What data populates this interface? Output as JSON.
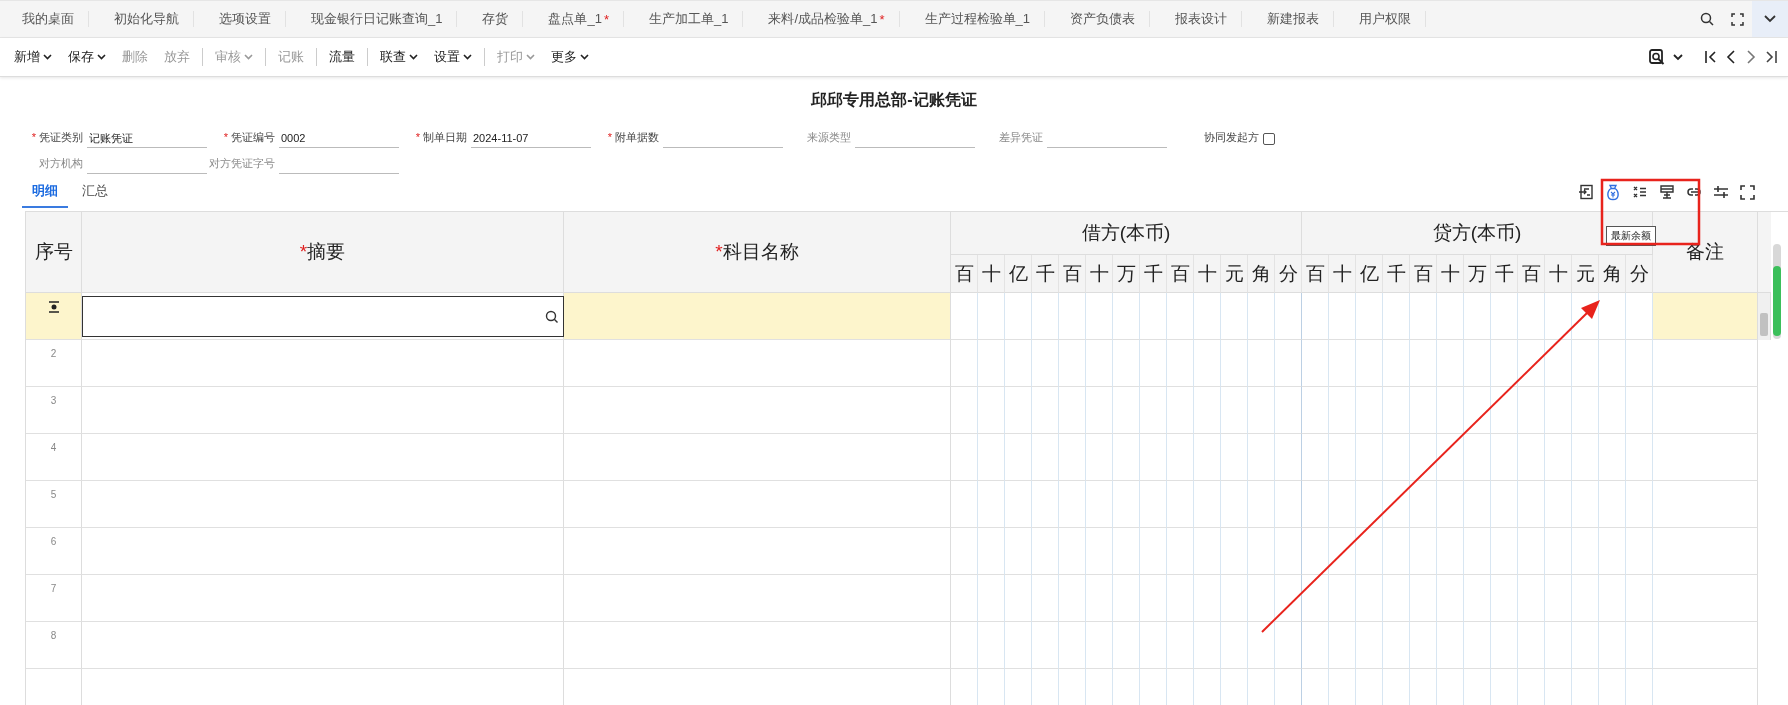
{
  "tabs": [
    {
      "label": "我的桌面",
      "selected": false
    },
    {
      "label": "初始化导航",
      "selected": false
    },
    {
      "label": "选项设置",
      "selected": false
    },
    {
      "label": "现金银行日记账查询_1",
      "selected": false
    },
    {
      "label": "存货",
      "selected": false
    },
    {
      "label": "盘点单_1",
      "selected": false,
      "mark": "*"
    },
    {
      "label": "生产加工单_1",
      "selected": false
    },
    {
      "label": "来料/成品检验单_1",
      "selected": false,
      "mark": "*"
    },
    {
      "label": "生产过程检验单_1",
      "selected": false
    },
    {
      "label": "资产负债表",
      "selected": false
    },
    {
      "label": "报表设计",
      "selected": false
    },
    {
      "label": "新建报表",
      "selected": false
    },
    {
      "label": "用户权限",
      "selected": false
    }
  ],
  "toolbar": [
    {
      "label": "新增",
      "dropdown": true,
      "disabled": false,
      "divider": false
    },
    {
      "label": "保存",
      "dropdown": true,
      "disabled": false,
      "divider": false
    },
    {
      "label": "删除",
      "dropdown": false,
      "disabled": true,
      "divider": false
    },
    {
      "label": "放弃",
      "dropdown": false,
      "disabled": true,
      "divider": false
    },
    {
      "label": "审核",
      "dropdown": true,
      "disabled": true,
      "divider": true
    },
    {
      "label": "记账",
      "dropdown": false,
      "disabled": true,
      "divider": true
    },
    {
      "label": "流量",
      "dropdown": false,
      "disabled": false,
      "divider": true
    },
    {
      "label": "联查",
      "dropdown": true,
      "disabled": false,
      "divider": true
    },
    {
      "label": "设置",
      "dropdown": true,
      "disabled": false,
      "divider": false
    },
    {
      "label": "打印",
      "dropdown": true,
      "disabled": true,
      "divider": true
    },
    {
      "label": "更多",
      "dropdown": true,
      "disabled": false,
      "divider": false
    }
  ],
  "title": "邱邱专用总部-记账凭证",
  "form_row_1": [
    {
      "kind": "text",
      "label": "凭证类别",
      "required_mark": "*",
      "value": "记账凭证"
    },
    {
      "kind": "text",
      "label": "凭证编号",
      "required_mark": "*",
      "value": "0002"
    },
    {
      "kind": "text",
      "label": "制单日期",
      "required_mark": "*",
      "value": "2024-11-07"
    },
    {
      "kind": "text",
      "label": "附单据数",
      "required_mark": "*"
    },
    {
      "kind": "text",
      "label": "来源类型"
    },
    {
      "kind": "text",
      "label": "差异凭证"
    },
    {
      "kind": "checkbox",
      "label": "协同发起方",
      "checked": false
    }
  ],
  "form_row_2": [
    {
      "kind": "text",
      "label": "对方机构"
    },
    {
      "kind": "text",
      "label": "对方凭证字号"
    }
  ],
  "view_tabs": [
    {
      "label": "明细",
      "selected": true
    },
    {
      "label": "汇总",
      "selected": false
    }
  ],
  "tooltip": "最新余额",
  "table": {
    "columns": [
      {
        "label": "序号"
      },
      {
        "label": "摘要",
        "required_mark": "*"
      },
      {
        "label": "科目名称",
        "required_mark": "*"
      }
    ],
    "debit": {
      "label": "借方(本币)",
      "digits": [
        "百",
        "十",
        "亿",
        "千",
        "百",
        "十",
        "万",
        "千",
        "百",
        "十",
        "元",
        "角",
        "分"
      ]
    },
    "credit": {
      "label": "贷方(本币)",
      "digits": [
        "百",
        "十",
        "亿",
        "千",
        "百",
        "十",
        "万",
        "千",
        "百",
        "十",
        "元",
        "角",
        "分"
      ]
    },
    "remark": {
      "label": "备注"
    },
    "rows": [
      {
        "kind": "editing"
      },
      {
        "kind": "plain",
        "number": "2"
      },
      {
        "kind": "plain",
        "number": "3"
      },
      {
        "kind": "plain",
        "number": "4"
      },
      {
        "kind": "plain",
        "number": "5"
      },
      {
        "kind": "plain",
        "number": "6"
      },
      {
        "kind": "plain",
        "number": "7"
      },
      {
        "kind": "plain",
        "number": "8"
      },
      {
        "kind": "plain"
      }
    ]
  }
}
